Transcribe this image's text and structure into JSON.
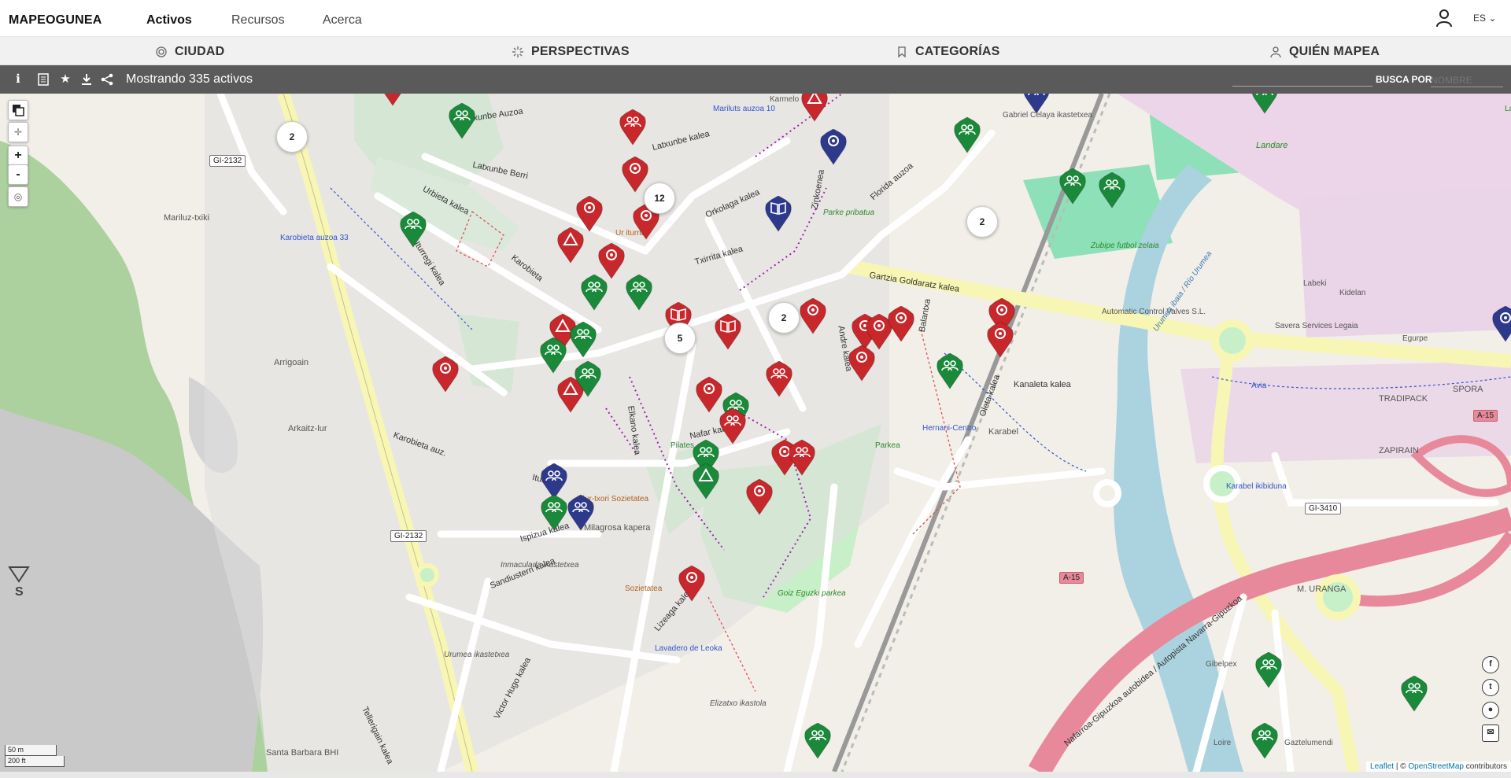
{
  "brand": "MAPEOGUNEA",
  "nav": {
    "activos": "Activos",
    "recursos": "Recursos",
    "acerca": "Acerca"
  },
  "lang": "ES",
  "filters": {
    "ciudad": "CIUDAD",
    "perspectivas": "PERSPECTIVAS",
    "categorias": "CATEGORÍAS",
    "quien": "QUIÉN MAPEA"
  },
  "toolbar": {
    "status": "Mostrando 335 activos",
    "search_by": "BUSCA POR",
    "search_placeholder": "NOMBRE"
  },
  "map": {
    "zoom_in": "+",
    "zoom_out": "-",
    "clusters": [
      "2",
      "12",
      "2",
      "2",
      "5"
    ],
    "scale_m": "50 m",
    "scale_ft": "200 ft",
    "attribution_leaflet": "Leaflet",
    "attribution_sep": "| ©",
    "attribution_osm": "OpenStreetMap",
    "attribution_tail": "contributors",
    "streets": [
      "Latxunbe Auzoa",
      "Latxunbe Berri",
      "Urbieta kalea",
      "Karobieta",
      "Iturregi kalea",
      "Latxunbe kalea",
      "Orkolaga kalea",
      "Txirrita kalea",
      "Zinkoenea",
      "Gartzia Goldaratz kalea",
      "Andre kalea",
      "Oleta kalea",
      "Elkano kalea",
      "Nafar kalea",
      "Karobieta auz.",
      "Iturregi",
      "Ispizua kalea",
      "Sandiusterri kalea",
      "Lizeaga kalea",
      "Victor Hugo kalea",
      "Tellerigain kalea",
      "Kanaleta kalea",
      "Florida auzoa",
      "Balantxa"
    ],
    "places": [
      "Mariluz-txiki",
      "Arrigoain",
      "Arkaitz-lur",
      "Karobieta auzoa 33",
      "Parke pribatua",
      "Gabriel Celaya ikastetxea",
      "Landare",
      "Zubipe futbol zelaia",
      "Hernani-Centro",
      "Karabel",
      "Milagrosa kapera",
      "Inmaculada ikastetxea",
      "Urumea ikastetxea",
      "Santa Barbara BHI",
      "Goiz Eguzki parkea",
      "Elizatxo ikastola",
      "Lavadero de Leoka",
      "Elur-txori Sozietatea",
      "Sozietatea",
      "Parkea",
      "Pilates",
      "TRADIPACK",
      "SPORA",
      "ZAPIRAIN",
      "M. URANGA",
      "Karabel ikibiduna",
      "Automatic Control Valves S.L.",
      "Labeki",
      "Kidelan",
      "Egurpe",
      "Savera Services Legaia",
      "Gibelpex",
      "Loire",
      "Gaztelumendi",
      "Mariluts auzoa 10",
      "Karmelo",
      "Ur iturria",
      "Landare",
      "Avia"
    ],
    "shields": [
      "GI-2132",
      "GI-2132",
      "GI-3410",
      "A-15",
      "A-15"
    ],
    "motorway": "Nafarroa-Gipuzkoa autobidea / Autopista Navarra-Gipuzkoa",
    "river": "Urumea ibaia / Río Urumea",
    "colors": {
      "red": "#c8282c",
      "green": "#1a8a3a",
      "blue": "#2d3a8c",
      "park": "#c8f0c8",
      "road_yellow": "#f7f6b4",
      "motorway": "#e7899b",
      "water": "#aad3df",
      "forest": "#add19e",
      "quarry": "#c5c5c5"
    }
  }
}
